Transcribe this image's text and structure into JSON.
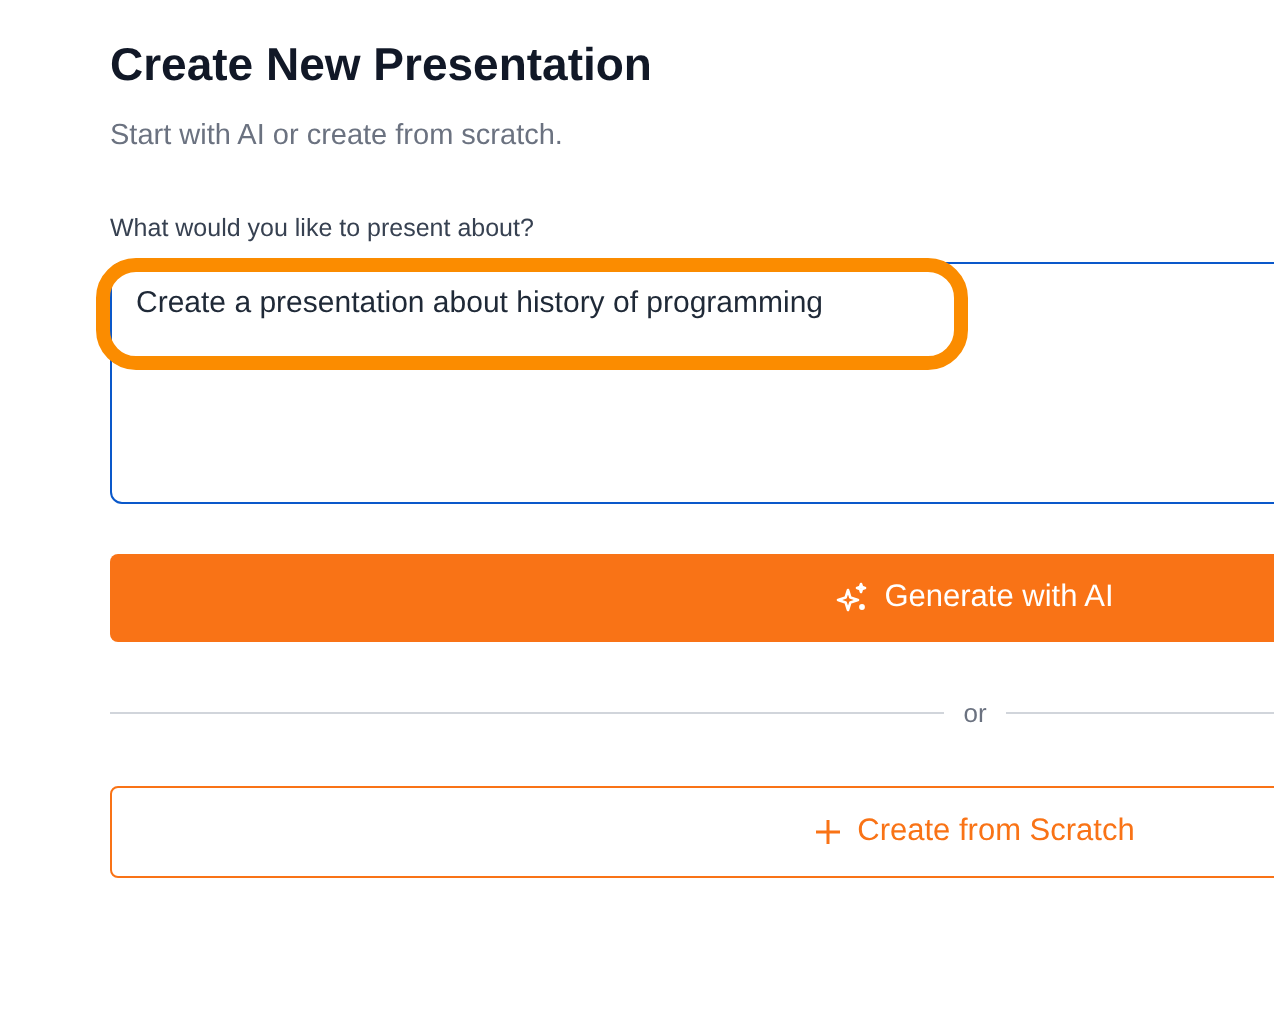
{
  "header": {
    "title": "Create New Presentation",
    "subtitle": "Start with AI or create from scratch."
  },
  "prompt": {
    "label": "What would you like to present about?",
    "value": "Create a presentation about history of programming",
    "focused": true,
    "highlighted": true
  },
  "generate_button": {
    "label": "Generate with AI"
  },
  "divider": {
    "label": "or"
  },
  "scratch_button": {
    "label": "Create from Scratch"
  }
}
